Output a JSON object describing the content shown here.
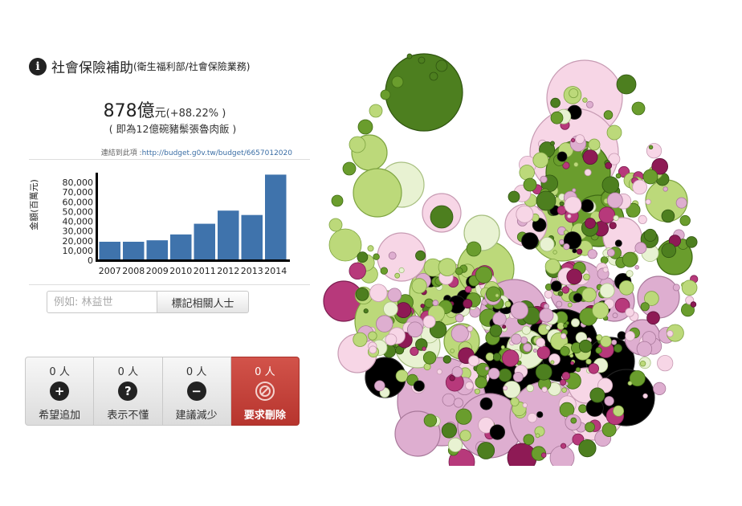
{
  "item": {
    "name": "社會保險補助",
    "department": "(衛生福利部/社會保險業務)",
    "amount": "878億",
    "amount_unit": "元",
    "change": "(+88.22% )",
    "equivalent": "( 即為12億碗豬鬃張魯肉飯 )",
    "link_label": "連結到此項 :",
    "link_url": "http://budget.g0v.tw/budget/6657012020"
  },
  "chart_data": {
    "type": "bar",
    "ylabel": "金額(百萬元)",
    "categories": [
      "2007",
      "2008",
      "2009",
      "2010",
      "2011",
      "2012",
      "2013",
      "2014"
    ],
    "values": [
      19000,
      19000,
      20500,
      26500,
      37500,
      51000,
      46500,
      88000
    ],
    "yticks": [
      "0",
      "10,000",
      "20,000",
      "30,000",
      "40,000",
      "50,000",
      "60,000",
      "70,000",
      "80,000"
    ],
    "ylim": [
      0,
      90000
    ],
    "bar_color": "#3f73ac"
  },
  "search": {
    "placeholder": "例如: 林益世",
    "button_label": "標記相關人士"
  },
  "votes": [
    {
      "count": "0 人",
      "label": "希望追加",
      "icon": "plus-icon"
    },
    {
      "count": "0 人",
      "label": "表示不懂",
      "icon": "question-icon"
    },
    {
      "count": "0 人",
      "label": "建議減少",
      "icon": "minus-icon"
    },
    {
      "count": "0 人",
      "label": "要求刪除",
      "icon": "ban-icon"
    }
  ],
  "colors": {
    "dark_green": "#4d7f1f",
    "green": "#6a9d2d",
    "light_green": "#bcd97a",
    "pale_green": "#e8f2d2",
    "pale_pink": "#f7d6e6",
    "pink": "#deaed0",
    "magenta": "#b7397b",
    "dark_magenta": "#8e1a55",
    "black": "#000000"
  }
}
